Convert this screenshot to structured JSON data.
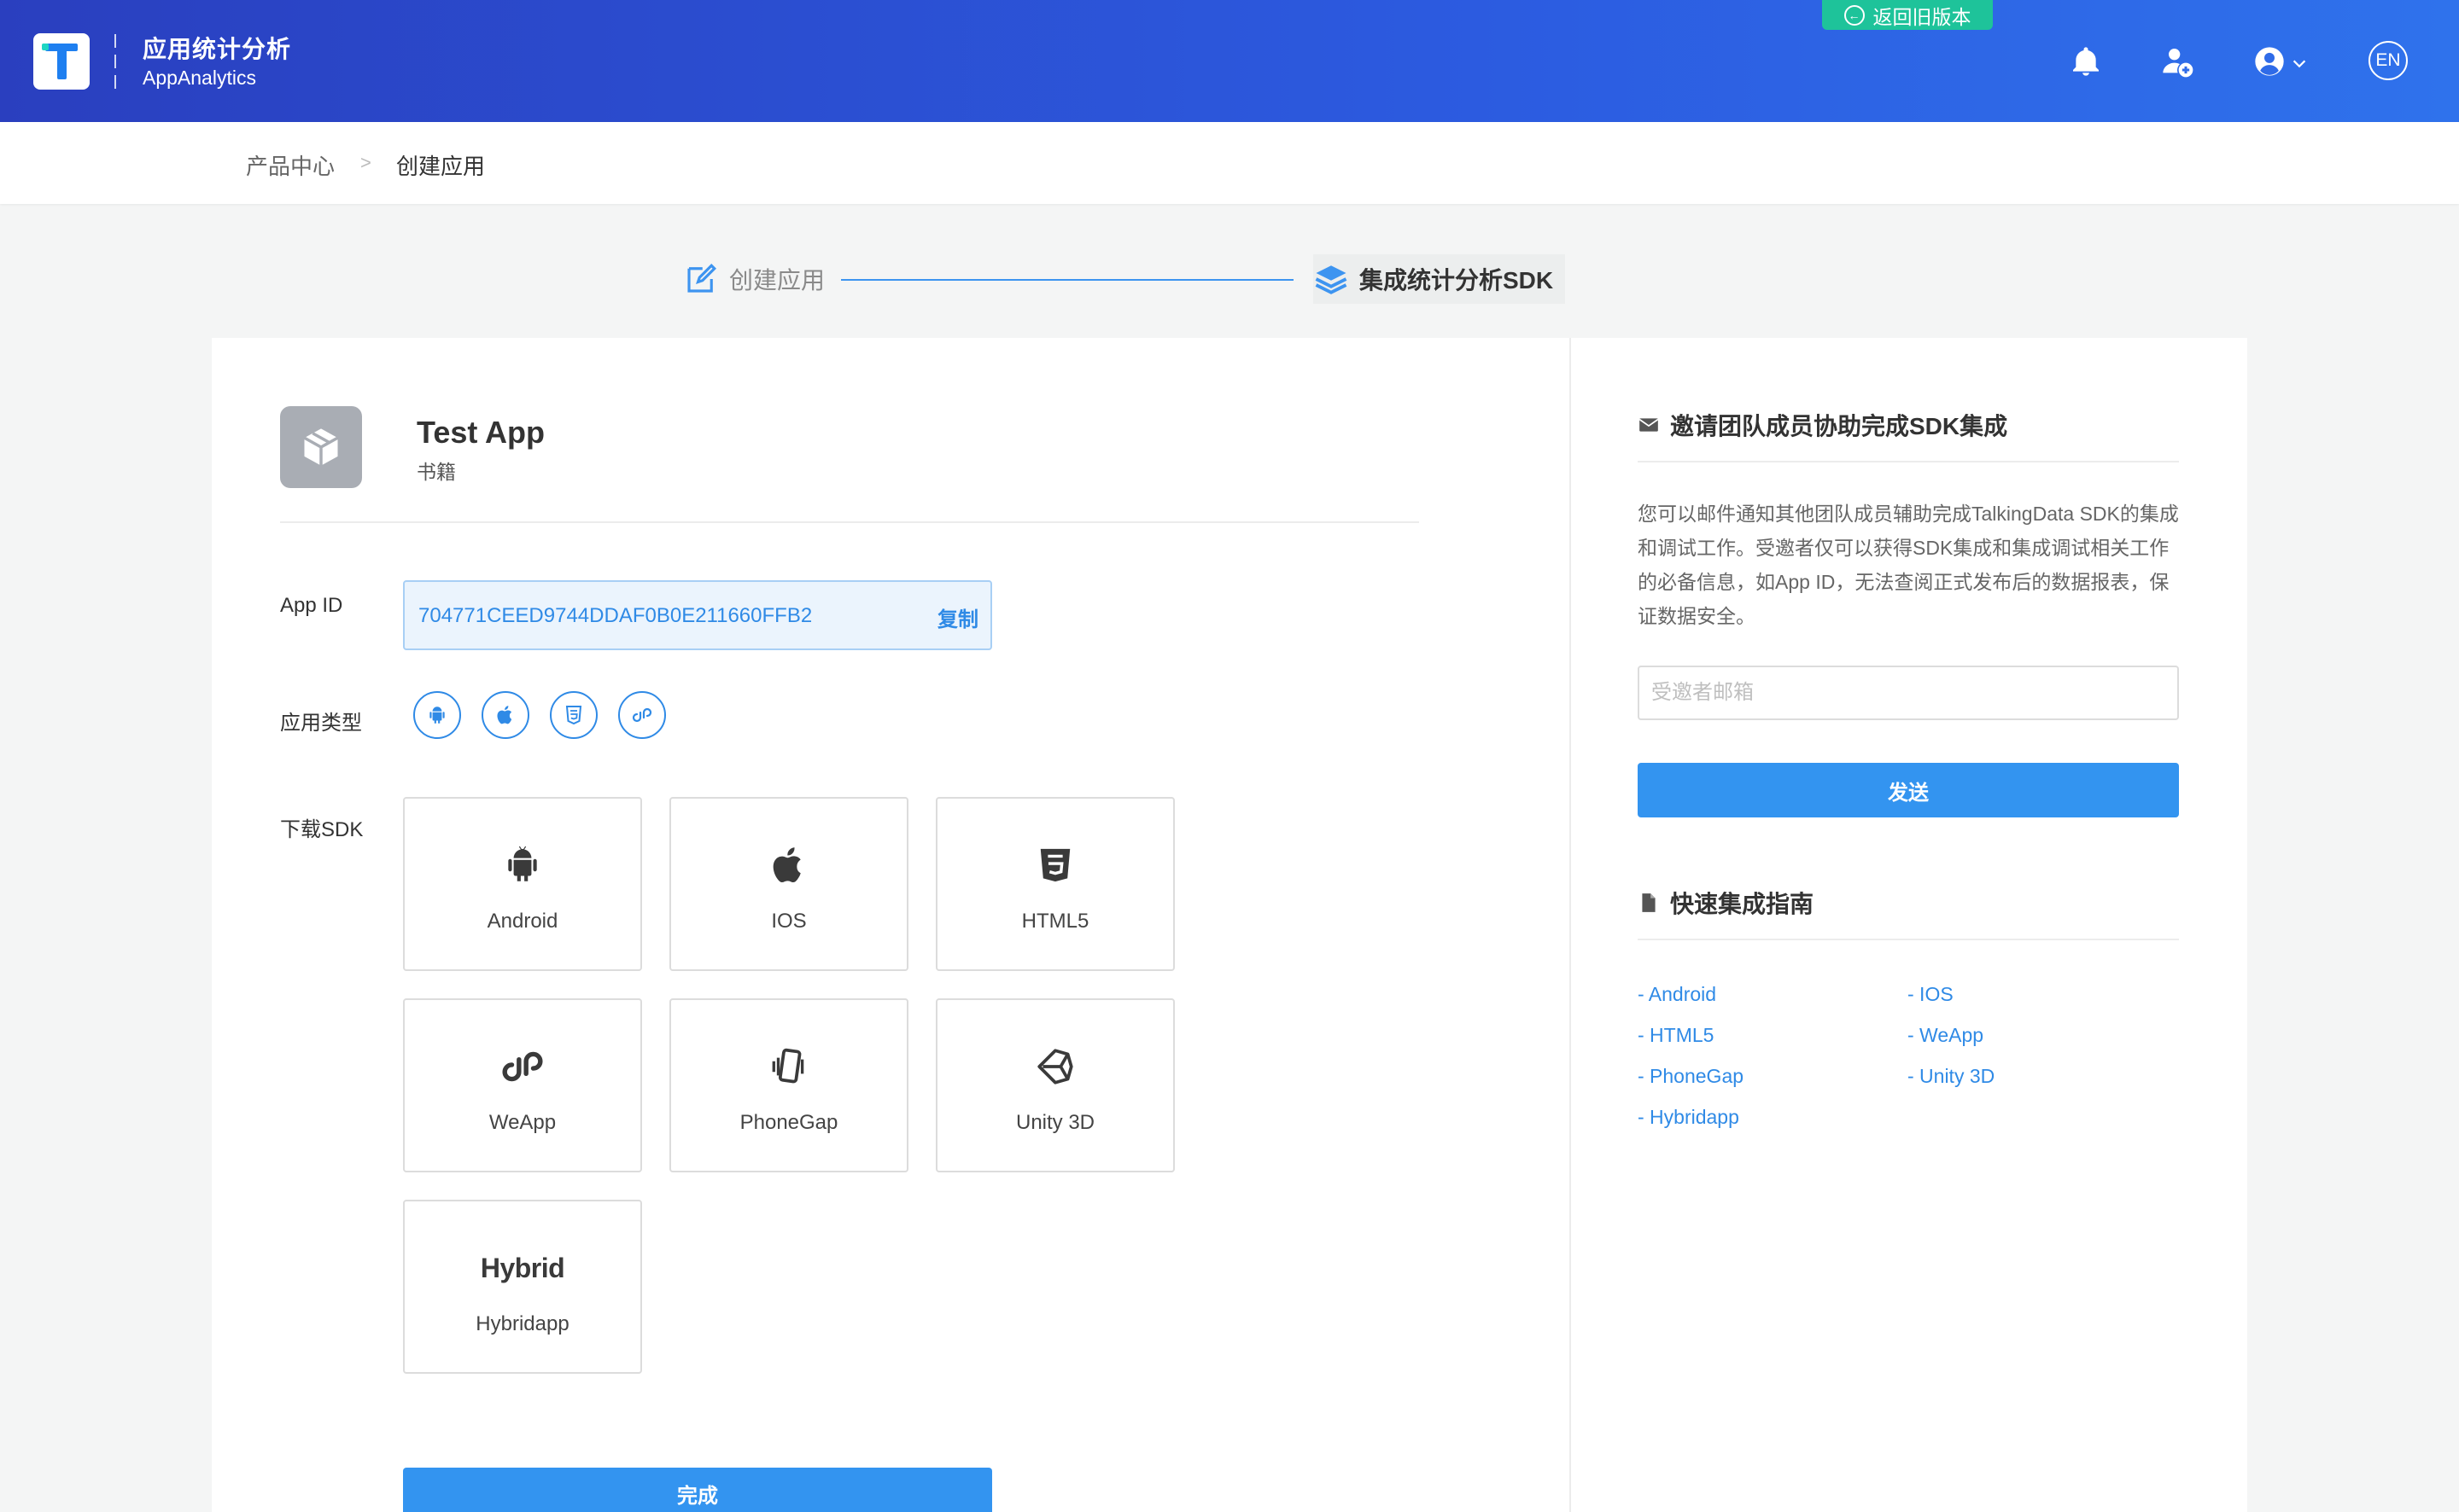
{
  "header": {
    "title_cn": "应用统计分析",
    "title_en": "AppAnalytics",
    "back_old_label": "返回旧版本",
    "lang_label": "EN",
    "icons": [
      "bell-icon",
      "add-user-icon",
      "user-account-icon",
      "chevron-down-icon"
    ]
  },
  "breadcrumb": {
    "items": [
      "产品中心",
      "创建应用"
    ],
    "separator": ">"
  },
  "steps": {
    "step1": "创建应用",
    "step2": "集成统计分析SDK"
  },
  "app": {
    "name": "Test App",
    "category": "书籍"
  },
  "fields": {
    "app_id_label": "App ID",
    "app_id_value": "704771CEED9744DDAF0B0E211660FFB2",
    "copy_label": "复制",
    "app_type_label": "应用类型",
    "download_sdk_label": "下载SDK"
  },
  "app_types": [
    "android-icon",
    "apple-icon",
    "html5-icon",
    "weapp-icon"
  ],
  "sdk_tiles": [
    {
      "name": "Android",
      "icon": "android-icon"
    },
    {
      "name": "IOS",
      "icon": "apple-icon"
    },
    {
      "name": "HTML5",
      "icon": "html5-icon"
    },
    {
      "name": "WeApp",
      "icon": "weapp-icon"
    },
    {
      "name": "PhoneGap",
      "icon": "phonegap-icon"
    },
    {
      "name": "Unity 3D",
      "icon": "unity-icon"
    },
    {
      "name": "Hybridapp",
      "icon": "hybrid-icon",
      "icon_text": "Hybrid"
    }
  ],
  "done_label": "完成",
  "invite": {
    "title": "邀请团队成员协助完成SDK集成",
    "description": "您可以邮件通知其他团队成员辅助完成TalkingData SDK的集成和调试工作。受邀者仅可以获得SDK集成和集成调试相关工作的必备信息，如App ID，无法查阅正式发布后的数据报表，保证数据安全。",
    "email_placeholder": "受邀者邮箱",
    "email_value": "",
    "send_label": "发送"
  },
  "guide": {
    "title": "快速集成指南",
    "links": [
      "- Android",
      "- IOS",
      "- HTML5",
      "- WeApp",
      "- PhoneGap",
      "- Unity 3D",
      "- Hybridapp"
    ]
  },
  "colors": {
    "header_gradient_start": "#2a3fbf",
    "header_gradient_end": "#2f72ec",
    "accent_blue": "#3394f0",
    "back_old_green": "#1ec39a"
  }
}
